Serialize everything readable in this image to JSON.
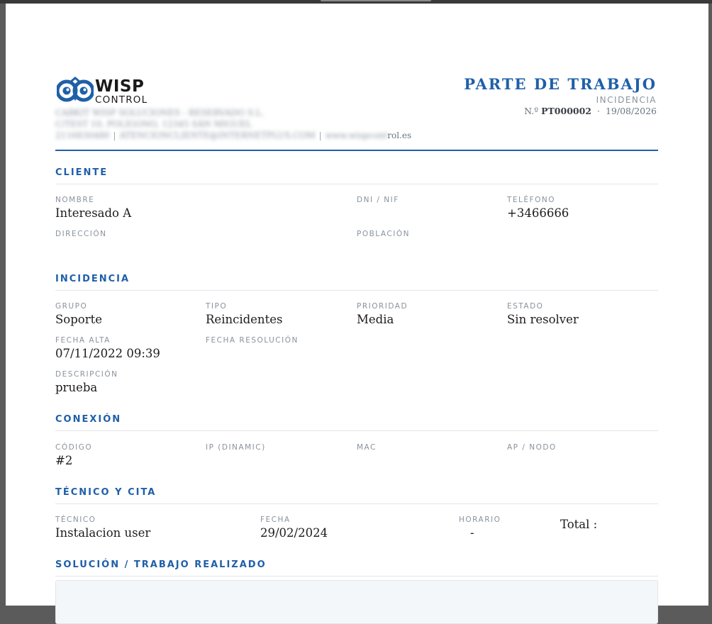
{
  "company": {
    "logo_wisp": "WISP",
    "logo_control": "CONTROL",
    "name_line": "CABKIT WISP SOLUCIONES - RESERVADO S.L.",
    "address_line": "C/TEST 10, POLÍGONO, 12345 SÁN MIGUEL",
    "phone": "2116830480",
    "email": "ATENCIONCLIENTE@INTERNETPLUS.COM",
    "web_hidden": "www.wispcont",
    "web_visible": "rol.es",
    "sep": "|"
  },
  "document": {
    "title": "PARTE DE TRABAJO",
    "type": "INCIDENCIA",
    "number_prefix": "N.º",
    "number": "PT000002",
    "dot": "·",
    "date": "19/08/2026"
  },
  "cliente": {
    "title": "CLIENTE",
    "nombre_label": "NOMBRE",
    "nombre": "Interesado A",
    "dni_label": "DNI / NIF",
    "dni": "",
    "telefono_label": "TELÉFONO",
    "telefono": "+3466666",
    "direccion_label": "DIRECCIÓN",
    "direccion": "",
    "poblacion_label": "POBLACIÓN",
    "poblacion": ""
  },
  "incidencia": {
    "title": "INCIDENCIA",
    "grupo_label": "GRUPO",
    "grupo": "Soporte",
    "tipo_label": "TIPO",
    "tipo": "Reincidentes",
    "prioridad_label": "PRIORIDAD",
    "prioridad": "Media",
    "estado_label": "ESTADO",
    "estado": "Sin resolver",
    "fecha_alta_label": "FECHA ALTA",
    "fecha_alta": "07/11/2022 09:39",
    "fecha_resolucion_label": "FECHA RESOLUCIÓN",
    "fecha_resolucion": "",
    "descripcion_label": "DESCRIPCIÓN",
    "descripcion": "prueba"
  },
  "conexion": {
    "title": "CONEXIÓN",
    "codigo_label": "CÓDIGO",
    "codigo": "#2",
    "ip_label": "IP (DINAMIC)",
    "ip": "",
    "mac_label": "MAC",
    "mac": "",
    "ap_label": "AP / NODO",
    "ap": ""
  },
  "tecnico": {
    "title": "TÉCNICO Y CITA",
    "tecnico_label": "TÉCNICO",
    "tecnico": "Instalacion user",
    "fecha_label": "FECHA",
    "fecha": "29/02/2024",
    "horario_label": "HORARIO",
    "horario": "-",
    "total": "Total :"
  },
  "solucion": {
    "title": "SOLUCIÓN / TRABAJO REALIZADO",
    "text": ""
  },
  "colors": {
    "accent": "#1f5fa8",
    "label": "#8a929c",
    "rule": "#e1e5ea"
  }
}
